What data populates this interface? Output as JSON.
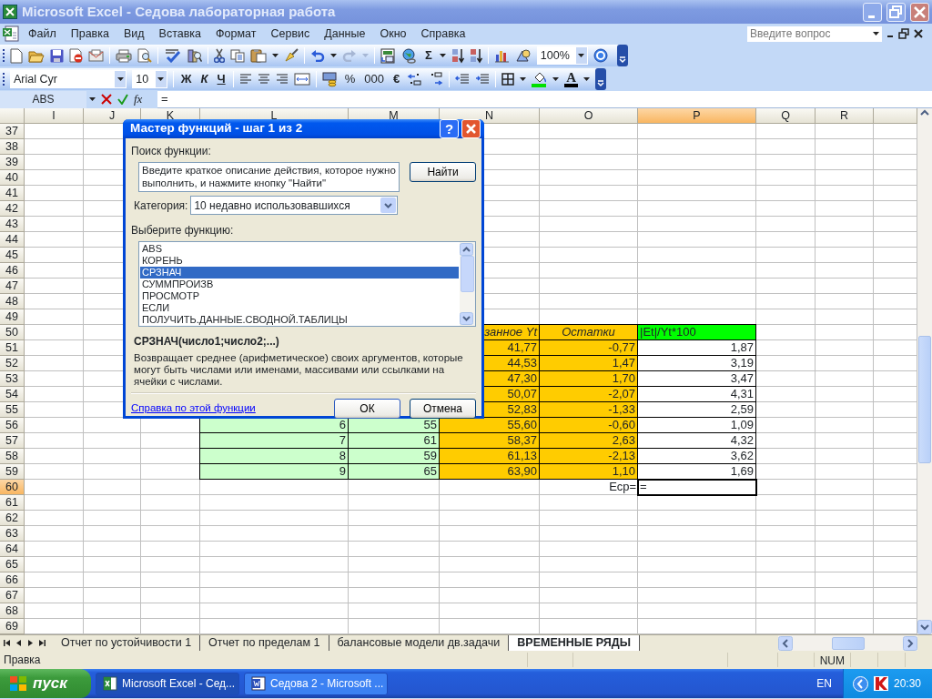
{
  "window": {
    "title": "Microsoft Excel - Седова лабораторная работа"
  },
  "menu": {
    "items": [
      "Файл",
      "Правка",
      "Вид",
      "Вставка",
      "Формат",
      "Сервис",
      "Данные",
      "Окно",
      "Справка"
    ],
    "help_box": {
      "placeholder": "Введите вопрос"
    }
  },
  "standard_toolbar": {
    "sum_label": "Σ",
    "zoom": "100%"
  },
  "formatting_toolbar": {
    "font": "Arial Cyr",
    "size": "10",
    "bold_label": "Ж",
    "italic_label": "К",
    "underline_label": "Ч",
    "percent_label": "%",
    "thousands_label": "000",
    "euro_label": "€",
    "font_color_label": "A"
  },
  "formula_bar": {
    "name_box": "ABS",
    "fx_label": "fx",
    "formula": "="
  },
  "sheet": {
    "columns": [
      {
        "label": "I",
        "selected": false
      },
      {
        "label": "J",
        "selected": false
      },
      {
        "label": "K",
        "selected": false
      },
      {
        "label": "L",
        "selected": false
      },
      {
        "label": "M",
        "selected": false
      },
      {
        "label": "N",
        "selected": false
      },
      {
        "label": "O",
        "selected": false
      },
      {
        "label": "P",
        "selected": true
      },
      {
        "label": "Q",
        "selected": false
      },
      {
        "label": "R",
        "selected": false
      }
    ],
    "rows": [
      {
        "label": "37",
        "selected": false
      },
      {
        "label": "38",
        "selected": false
      },
      {
        "label": "39",
        "selected": false
      },
      {
        "label": "40",
        "selected": false
      },
      {
        "label": "41",
        "selected": false
      },
      {
        "label": "42",
        "selected": false
      },
      {
        "label": "43",
        "selected": false
      },
      {
        "label": "44",
        "selected": false
      },
      {
        "label": "45",
        "selected": false
      },
      {
        "label": "46",
        "selected": false
      },
      {
        "label": "47",
        "selected": false
      },
      {
        "label": "48",
        "selected": false
      },
      {
        "label": "49",
        "selected": false
      },
      {
        "label": "50",
        "selected": false,
        "cells": [
          {
            "kind": "covered"
          },
          {
            "kind": "covered"
          },
          {
            "kind": "clipped",
            "text": "занное Yt",
            "selected": false
          },
          {
            "kind": "header",
            "text": "Остатки",
            "selected": false
          },
          {
            "kind": "bright",
            "text": "|Et|/Yt*100",
            "selected": false
          }
        ]
      },
      {
        "label": "51",
        "selected": false,
        "cells": [
          {
            "kind": "covered"
          },
          {
            "kind": "covered"
          },
          {
            "kind": "orange",
            "text": "41,77",
            "selected": false
          },
          {
            "kind": "orange",
            "text": "-0,77",
            "selected": false
          },
          {
            "kind": "white",
            "text": "1,87",
            "selected": false
          }
        ]
      },
      {
        "label": "52",
        "selected": false,
        "cells": [
          {
            "kind": "covered"
          },
          {
            "kind": "covered"
          },
          {
            "kind": "orange",
            "text": "44,53",
            "selected": false
          },
          {
            "kind": "orange",
            "text": "1,47",
            "selected": false
          },
          {
            "kind": "white",
            "text": "3,19",
            "selected": false
          }
        ]
      },
      {
        "label": "53",
        "selected": false,
        "cells": [
          {
            "kind": "covered"
          },
          {
            "kind": "covered"
          },
          {
            "kind": "orange",
            "text": "47,30",
            "selected": false
          },
          {
            "kind": "orange",
            "text": "1,70",
            "selected": false
          },
          {
            "kind": "white",
            "text": "3,47",
            "selected": false
          }
        ]
      },
      {
        "label": "54",
        "selected": false,
        "cells": [
          {
            "kind": "covered"
          },
          {
            "kind": "covered"
          },
          {
            "kind": "orange",
            "text": "50,07",
            "selected": false
          },
          {
            "kind": "orange",
            "text": "-2,07",
            "selected": false
          },
          {
            "kind": "white",
            "text": "4,31",
            "selected": false
          }
        ]
      },
      {
        "label": "55",
        "selected": false,
        "cells": [
          {
            "kind": "covered"
          },
          {
            "kind": "covered"
          },
          {
            "kind": "orange",
            "text": "52,83",
            "selected": false
          },
          {
            "kind": "orange",
            "text": "-1,33",
            "selected": false
          },
          {
            "kind": "white",
            "text": "2,59",
            "selected": false
          }
        ]
      },
      {
        "label": "56",
        "selected": false,
        "cells": [
          {
            "kind": "green",
            "text": "6",
            "selected": false
          },
          {
            "kind": "green",
            "text": "55",
            "selected": false
          },
          {
            "kind": "orange",
            "text": "55,60",
            "selected": false
          },
          {
            "kind": "orange",
            "text": "-0,60",
            "selected": false
          },
          {
            "kind": "white",
            "text": "1,09",
            "selected": false
          }
        ]
      },
      {
        "label": "57",
        "selected": false,
        "cells": [
          {
            "kind": "green",
            "text": "7",
            "selected": false
          },
          {
            "kind": "green",
            "text": "61",
            "selected": false
          },
          {
            "kind": "orange",
            "text": "58,37",
            "selected": false
          },
          {
            "kind": "orange",
            "text": "2,63",
            "selected": false
          },
          {
            "kind": "white",
            "text": "4,32",
            "selected": false
          }
        ]
      },
      {
        "label": "58",
        "selected": false,
        "cells": [
          {
            "kind": "green",
            "text": "8",
            "selected": false
          },
          {
            "kind": "green",
            "text": "59",
            "selected": false
          },
          {
            "kind": "orange",
            "text": "61,13",
            "selected": false
          },
          {
            "kind": "orange",
            "text": "-2,13",
            "selected": false
          },
          {
            "kind": "white",
            "text": "3,62",
            "selected": false
          }
        ]
      },
      {
        "label": "59",
        "selected": false,
        "cells": [
          {
            "kind": "green",
            "text": "9",
            "selected": false
          },
          {
            "kind": "green",
            "text": "65",
            "selected": false
          },
          {
            "kind": "orange",
            "text": "63,90",
            "selected": false
          },
          {
            "kind": "orange",
            "text": "1,10",
            "selected": false
          },
          {
            "kind": "white",
            "text": "1,69",
            "selected": false
          }
        ]
      },
      {
        "label": "60",
        "selected": true,
        "cells": [
          {
            "kind": "blank",
            "selected": false
          },
          {
            "kind": "blank",
            "selected": false
          },
          {
            "kind": "blank",
            "selected": false
          },
          {
            "kind": "label",
            "text": "Еср=",
            "selected": false
          },
          {
            "kind": "blank",
            "text": "=",
            "selected": true
          }
        ]
      },
      {
        "label": "61",
        "selected": false
      },
      {
        "label": "62",
        "selected": false
      },
      {
        "label": "63",
        "selected": false
      },
      {
        "label": "64",
        "selected": false
      },
      {
        "label": "65",
        "selected": false
      },
      {
        "label": "66",
        "selected": false
      },
      {
        "label": "67",
        "selected": false
      },
      {
        "label": "68",
        "selected": false
      },
      {
        "label": "69",
        "selected": false
      }
    ]
  },
  "dialog": {
    "title": "Мастер функций - шаг 1 из 2",
    "help_label": "?",
    "search_label": "Поиск функции:",
    "search_text": "Введите краткое описание действия, которое нужно выполнить, и нажмите кнопку \"Найти\"",
    "find_button": "Найти",
    "category_label": "Категория:",
    "category": "10 недавно использовавшихся",
    "list_label": "Выберите функцию:",
    "functions": [
      {
        "name": "ABS",
        "selected": false
      },
      {
        "name": "КОРЕНЬ",
        "selected": false
      },
      {
        "name": "СРЗНАЧ",
        "selected": true
      },
      {
        "name": "СУММПРОИЗВ",
        "selected": false
      },
      {
        "name": "ПРОСМОТР",
        "selected": false
      },
      {
        "name": "ЕСЛИ",
        "selected": false
      },
      {
        "name": "ПОЛУЧИТЬ.ДАННЫЕ.СВОДНОЙ.ТАБЛИЦЫ",
        "selected": false
      }
    ],
    "signature": "СРЗНАЧ(число1;число2;...)",
    "description": "Возвращает среднее (арифметическое) своих аргументов, которые могут быть числами или именами, массивами или ссылками на ячейки с числами.",
    "help_link": "Справка по этой функции",
    "ok_button": "ОК",
    "cancel_button": "Отмена"
  },
  "sheet_tabs": [
    {
      "label": "Отчет по устойчивости 1",
      "selected": false
    },
    {
      "label": "Отчет по пределам 1",
      "selected": false
    },
    {
      "label": "балансовые модели дв.задачи",
      "selected": false
    },
    {
      "label": "ВРЕМЕННЫЕ РЯДЫ",
      "selected": true
    }
  ],
  "status_bar": {
    "mode": "Правка",
    "num": "NUM"
  },
  "taskbar": {
    "start": "пуск",
    "tasks": [
      {
        "label": "Microsoft Excel - Сед...",
        "selected": true
      },
      {
        "label": "Седова 2 - Microsoft ...",
        "selected": false
      }
    ],
    "language": "EN",
    "time": "20:30"
  }
}
